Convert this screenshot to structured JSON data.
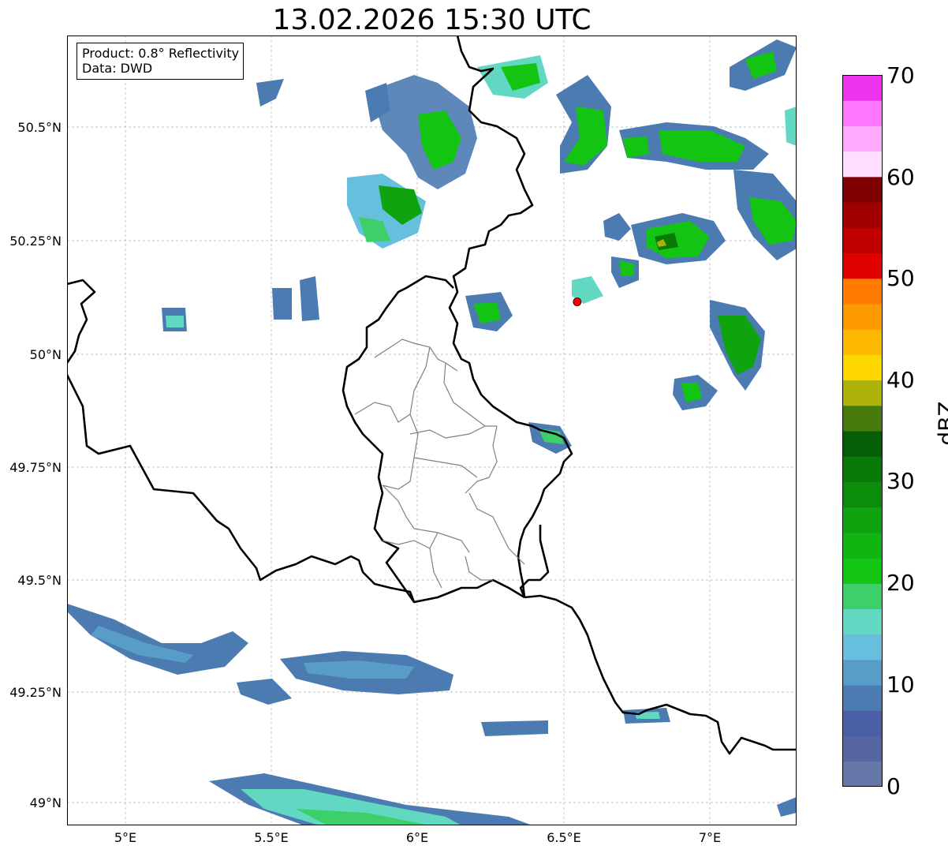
{
  "title": "13.02.2026 15:30 UTC",
  "info": {
    "product": "Product: 0.8° Reflectivity",
    "data": "Data: DWD"
  },
  "map": {
    "lon_range": [
      4.8,
      7.3
    ],
    "lat_range": [
      48.95,
      50.7
    ],
    "x_ticks": [
      {
        "value": 5.0,
        "label": "5°E"
      },
      {
        "value": 5.5,
        "label": "5.5°E"
      },
      {
        "value": 6.0,
        "label": "6°E"
      },
      {
        "value": 6.5,
        "label": "6.5°E"
      },
      {
        "value": 7.0,
        "label": "7°E"
      }
    ],
    "y_ticks": [
      {
        "value": 50.5,
        "label": "50.5°N"
      },
      {
        "value": 50.25,
        "label": "50.25°N"
      },
      {
        "value": 50.0,
        "label": "50°N"
      },
      {
        "value": 49.75,
        "label": "49.75°N"
      },
      {
        "value": 49.5,
        "label": "49.5°N"
      },
      {
        "value": 49.25,
        "label": "49.25°N"
      },
      {
        "value": 49.0,
        "label": "49°N"
      }
    ],
    "grid": true,
    "marker": {
      "lon": 6.548,
      "lat": 50.11,
      "color": "#ff0000"
    }
  },
  "colorbar": {
    "label": "dBZ",
    "min": 0,
    "max": 70,
    "step": 2.5,
    "ticks": [
      0,
      10,
      20,
      30,
      40,
      50,
      60,
      70
    ],
    "colors": [
      "#6677aa",
      "#5566a0",
      "#4a5fa5",
      "#4c7bb2",
      "#579dc8",
      "#66bfdc",
      "#62d8c2",
      "#3ccf6a",
      "#13c413",
      "#11b511",
      "#0fa30f",
      "#0b8d0b",
      "#087a08",
      "#065f06",
      "#467a0a",
      "#acb20a",
      "#ffd700",
      "#ffb800",
      "#ff9900",
      "#ff7c00",
      "#e00000",
      "#c00000",
      "#a00000",
      "#7e0000",
      "#ffddff",
      "#ffaaff",
      "#ff77ff",
      "#ee33ee"
    ]
  }
}
